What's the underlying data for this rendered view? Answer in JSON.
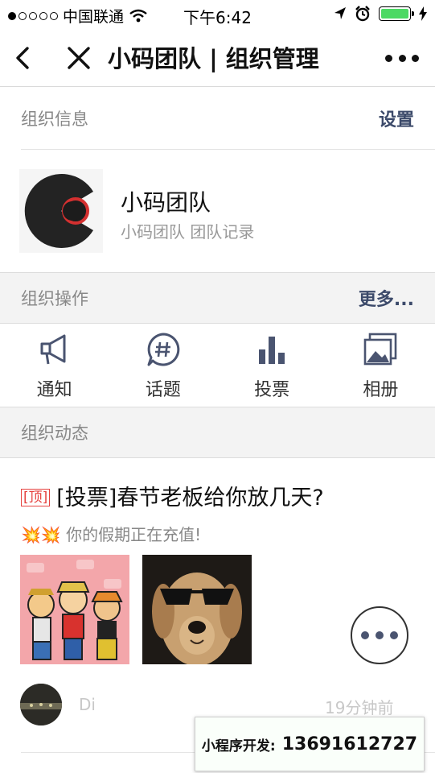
{
  "status_bar": {
    "carrier": "中国联通",
    "time": "下午6:42"
  },
  "nav": {
    "title": "小码团队 | 组织管理"
  },
  "org_info": {
    "section_label": "组织信息",
    "settings_label": "设置",
    "name": "小码团队",
    "description": "小码团队 团队记录"
  },
  "org_ops": {
    "section_label": "组织操作",
    "more_label": "更多...",
    "items": [
      {
        "label": "通知",
        "icon": "megaphone-icon"
      },
      {
        "label": "话题",
        "icon": "topic-hash-icon"
      },
      {
        "label": "投票",
        "icon": "bar-chart-icon"
      },
      {
        "label": "相册",
        "icon": "album-icon"
      }
    ]
  },
  "feed": {
    "section_label": "组织动态",
    "post": {
      "pin_tag": "[顶]",
      "title": "[投票]春节老板给你放几天?",
      "subtitle_emoji": "💥💥",
      "subtitle": "你的假期正在充值!",
      "author": "Di",
      "time": "19分钟前"
    }
  },
  "dev_badge": {
    "label": "小程序开发:",
    "phone": "13691612727"
  },
  "colors": {
    "accent_link": "#3c4a6a",
    "pin_red": "#e64340",
    "battery_green": "#4cd964"
  }
}
